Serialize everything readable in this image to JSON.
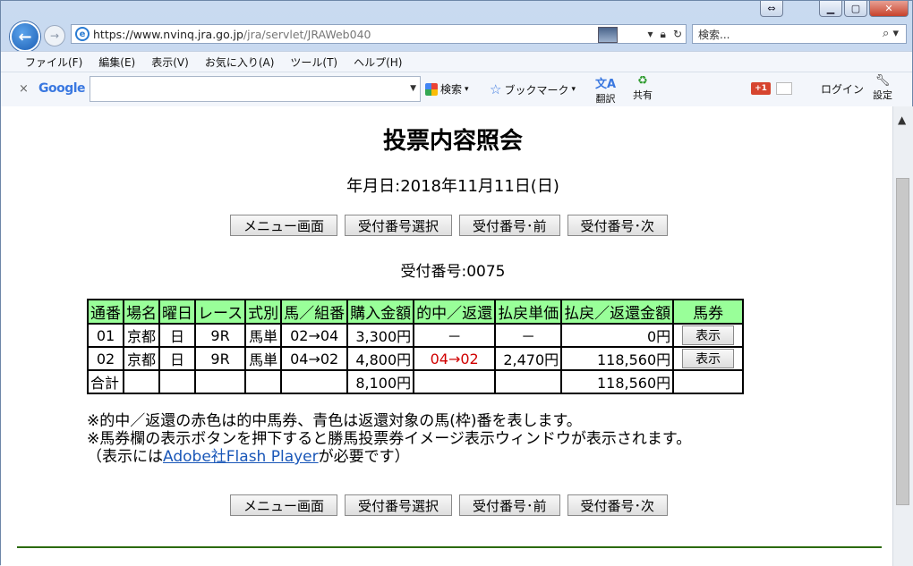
{
  "browser": {
    "url_host": "https://www.nvinq.jra.go.jp",
    "url_path": "/jra/servlet/JRAWeb040",
    "search_placeholder": "検索...",
    "menu": [
      "ファイル(F)",
      "編集(E)",
      "表示(V)",
      "お気に入り(A)",
      "ツール(T)",
      "ヘルプ(H)"
    ],
    "toolbar": {
      "close": "×",
      "google": "Google",
      "search_label": "検索",
      "bookmark_label": "ブックマーク",
      "translate_label": "翻訳",
      "share_label": "共有",
      "gplus": "+1",
      "login_label": "ログイン",
      "settings_label": "設定"
    }
  },
  "page": {
    "title": "投票内容照会",
    "date_line": "年月日:2018年11月11日(日)",
    "nav_buttons": [
      "メニュー画面",
      "受付番号選択",
      "受付番号･前",
      "受付番号･次"
    ],
    "receipt_line": "受付番号:0075",
    "table": {
      "headers": [
        "通番",
        "場名",
        "曜日",
        "レース",
        "式別",
        "馬／組番",
        "購入金額",
        "的中／返還",
        "払戻単価",
        "払戻／返還金額",
        "馬券"
      ],
      "rows": [
        [
          "01",
          "京都",
          "日",
          "9R",
          "馬単",
          "02→04",
          "3,300円",
          "－",
          "－",
          "0円",
          "表示"
        ],
        [
          "02",
          "京都",
          "日",
          "9R",
          "馬単",
          "04→02",
          "4,800円",
          "04→02",
          "2,470円",
          "118,560円",
          "表示"
        ]
      ],
      "total": {
        "label": "合計",
        "purchase": "8,100円",
        "payout": "118,560円"
      }
    },
    "notes": {
      "line1": "※的中／返還の赤色は的中馬券、青色は返還対象の馬(枠)番を表します。",
      "line2": "※馬券欄の表示ボタンを押下すると勝馬投票券イメージ表示ウィンドウが表示されます。",
      "line3_pre": "（表示には",
      "line3_link": "Adobe社Flash Player",
      "line3_post": "が必要です）"
    },
    "colors": {
      "header_bg": "#99ff99",
      "hit": "#d00000",
      "rule": "#2b6a0a"
    }
  }
}
